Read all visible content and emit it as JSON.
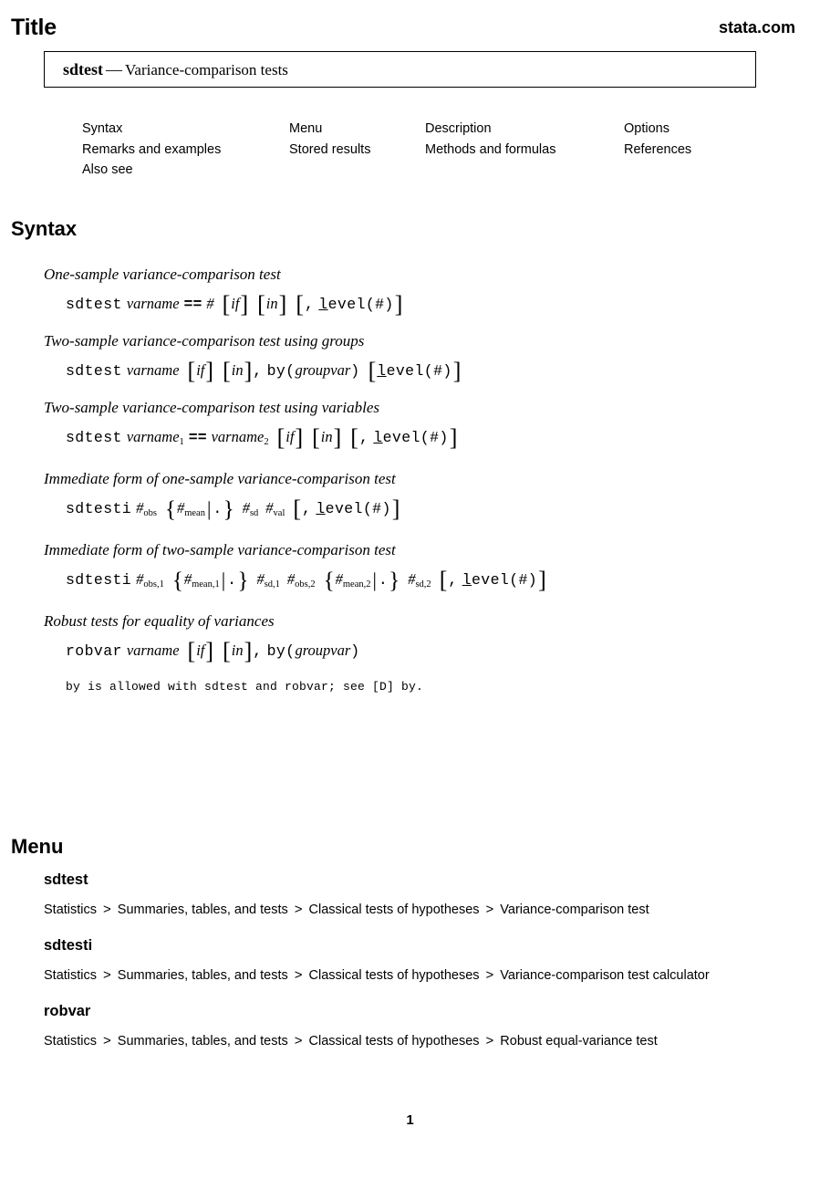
{
  "header": {
    "title": "Title",
    "site": "stata.com"
  },
  "title_box": {
    "command": "sdtest",
    "dash": "—",
    "description": "Variance-comparison tests"
  },
  "toc": {
    "columns": [
      {
        "items": [
          "Syntax",
          "Remarks and examples",
          "Also see"
        ]
      },
      {
        "items": [
          "Menu",
          "Stored results"
        ]
      },
      {
        "items": [
          "Description",
          "Methods and formulas"
        ]
      },
      {
        "items": [
          "Options",
          "References"
        ]
      }
    ]
  },
  "sections": {
    "syntax_heading": "Syntax",
    "menu_heading": "Menu"
  },
  "syntax": {
    "groups": [
      {
        "label": "One-sample variance-comparison test",
        "cmd": "sdtest",
        "varname": "varname",
        "eq": "==",
        "hash": "#",
        "if": "if",
        "in": "in",
        "comma": ",",
        "level_l": "l",
        "level_rest": "evel(#)"
      },
      {
        "label": "Two-sample variance-comparison test using groups",
        "cmd": "sdtest",
        "varname": "varname",
        "if": "if",
        "in": "in",
        "comma": ",",
        "by": "by(",
        "groupvar": "groupvar",
        "by_close": ")",
        "level_l": "l",
        "level_rest": "evel(#)"
      },
      {
        "label": "Two-sample variance-comparison test using variables",
        "cmd": "sdtest",
        "varname1": "varname",
        "sub1": "1",
        "eq": "==",
        "varname2": "varname",
        "sub2": "2",
        "if": "if",
        "in": "in",
        "comma": ",",
        "level_l": "l",
        "level_rest": "evel(#)"
      },
      {
        "label": "Immediate form of one-sample variance-comparison test",
        "cmd": "sdtesti",
        "hash": "#",
        "sub_obs": "obs",
        "sub_mean": "mean",
        "dot": ".",
        "sub_sd": "sd",
        "sub_val": "val",
        "comma": ",",
        "level_l": "l",
        "level_rest": "evel(#)"
      },
      {
        "label": "Immediate form of two-sample variance-comparison test",
        "cmd": "sdtesti",
        "hash": "#",
        "sub_obs1": "obs,1",
        "sub_mean1": "mean,1",
        "dot": ".",
        "sub_sd1": "sd,1",
        "sub_obs2": "obs,2",
        "sub_mean2": "mean,2",
        "sub_sd2": "sd,2",
        "comma": ",",
        "level_l": "l",
        "level_rest": "evel(#)"
      },
      {
        "label": "Robust tests for equality of variances",
        "cmd": "robvar",
        "varname": "varname",
        "if": "if",
        "in": "in",
        "comma": ",",
        "by": "by(",
        "groupvar": "groupvar",
        "by_close": ")"
      }
    ],
    "note": "by is allowed with sdtest and robvar; see [D] by."
  },
  "menu": {
    "entries": [
      {
        "command": "sdtest",
        "path": [
          "Statistics",
          "Summaries, tables, and tests",
          "Classical tests of hypotheses",
          "Variance-comparison test"
        ]
      },
      {
        "command": "sdtesti",
        "path": [
          "Statistics",
          "Summaries, tables, and tests",
          "Classical tests of hypotheses",
          "Variance-comparison test calculator"
        ]
      },
      {
        "command": "robvar",
        "path": [
          "Statistics",
          "Summaries, tables, and tests",
          "Classical tests of hypotheses",
          "Robust equal-variance test"
        ]
      }
    ],
    "separator": ">"
  },
  "footer": {
    "page_number": "1"
  }
}
